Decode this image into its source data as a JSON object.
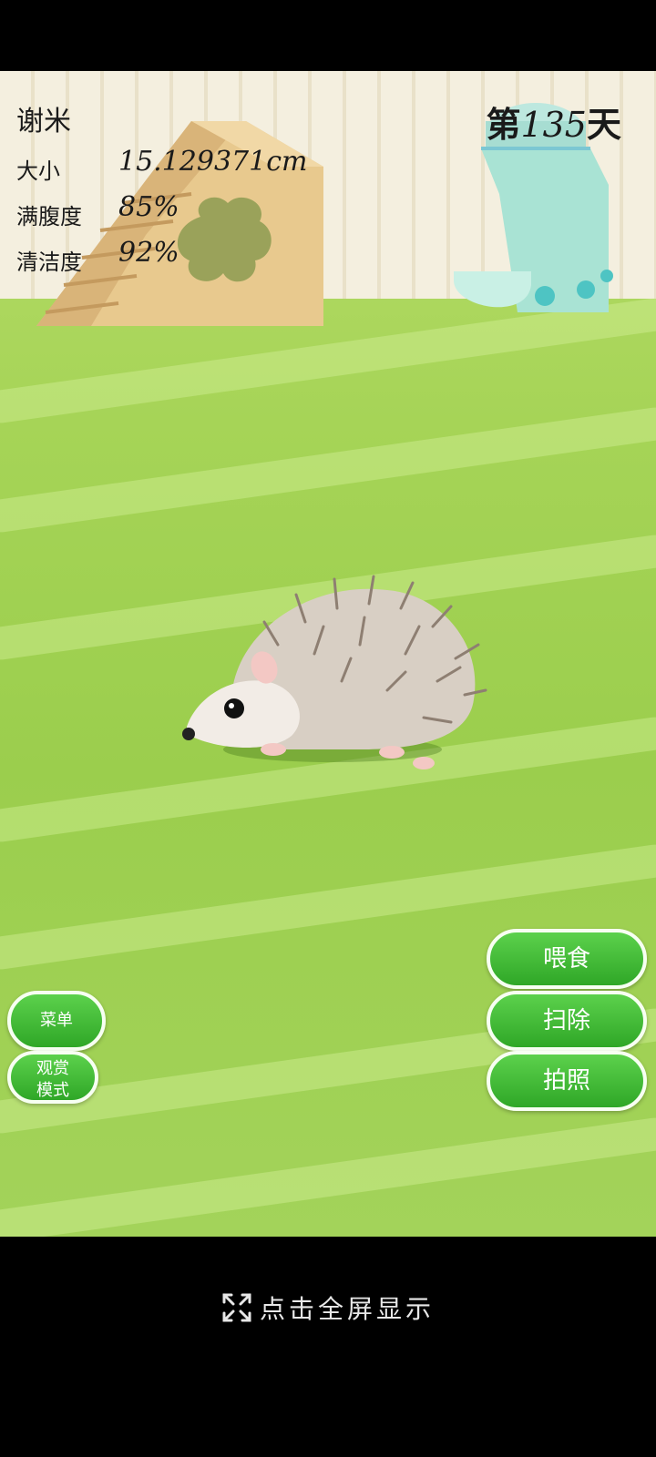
{
  "pet": {
    "name": "谢米",
    "size_label": "大小",
    "size_value": "15.129371cm",
    "hunger_label": "满腹度",
    "hunger_value": "85%",
    "clean_label": "清洁度",
    "clean_value": "92%"
  },
  "day": {
    "prefix": "第",
    "number": "135",
    "suffix": "天"
  },
  "left_buttons": {
    "menu_label": "菜单",
    "view_mode_line1": "观赏",
    "view_mode_line2": "模式"
  },
  "right_buttons": {
    "feed_label": "喂食",
    "clean_label": "扫除",
    "photo_label": "拍照"
  },
  "footer": {
    "fullscreen_label": "点击全屏显示"
  },
  "colors": {
    "button_green": "#3dbb33",
    "grass": "#a6d457"
  }
}
